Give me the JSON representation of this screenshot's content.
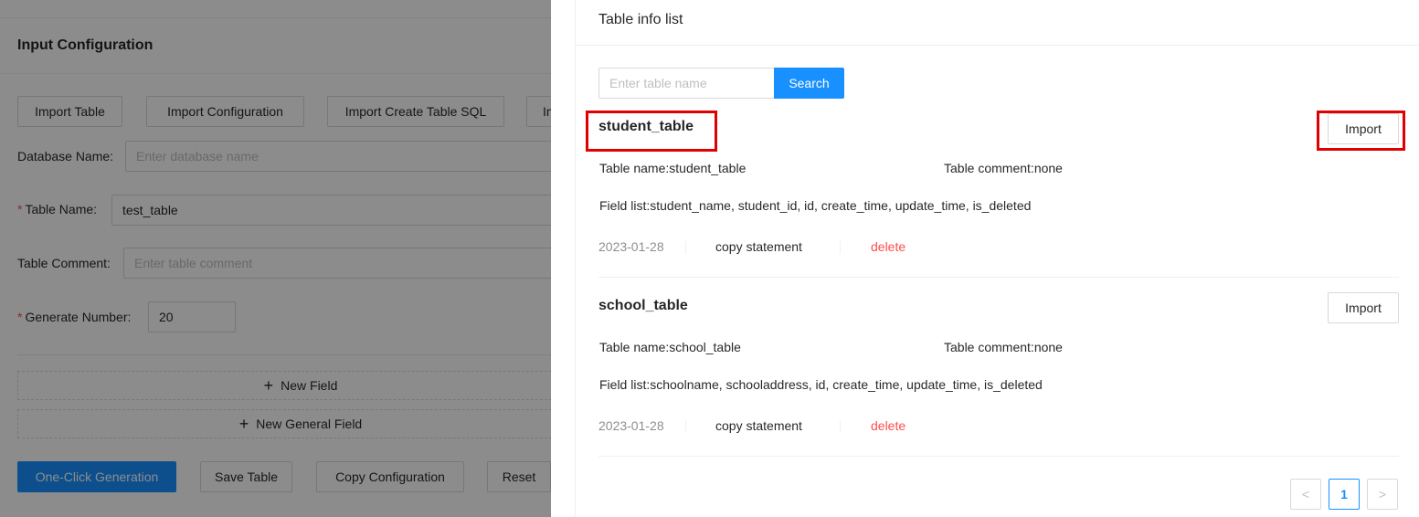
{
  "background_form": {
    "title": "Input Configuration",
    "toolbar": {
      "import_table": "Import Table",
      "import_configuration": "Import Configuration",
      "import_create_table_sql": "Import Create Table SQL",
      "import_more_truncated": "Im"
    },
    "fields": {
      "database_name": {
        "label": "Database Name:",
        "placeholder": "Enter database name",
        "value": ""
      },
      "table_name": {
        "label": "Table Name:",
        "required": true,
        "value": "test_table"
      },
      "table_comment": {
        "label": "Table Comment:",
        "placeholder": "Enter table comment",
        "value": ""
      },
      "generate_number": {
        "label": "Generate Number:",
        "required": true,
        "value": "20"
      }
    },
    "new_field_label": "New Field",
    "new_general_field_label": "New General Field",
    "actions": {
      "one_click_generation": "One-Click Generation",
      "save_table": "Save Table",
      "copy_configuration": "Copy Configuration",
      "reset": "Reset"
    }
  },
  "drawer": {
    "title": "Table info list",
    "search": {
      "placeholder": "Enter table name",
      "button_label": "Search"
    },
    "tables": [
      {
        "title": "student_table",
        "table_name_label": "Table name:",
        "table_name": "student_table",
        "table_comment_label": "Table comment:",
        "table_comment": "none",
        "field_list_label": "Field list:",
        "field_list": "student_name, student_id, id, create_time, update_time, is_deleted",
        "date": "2023-01-28",
        "copy_label": "copy statement",
        "delete_label": "delete",
        "import_label": "Import",
        "highlighted": true
      },
      {
        "title": "school_table",
        "table_name_label": "Table name:",
        "table_name": "school_table",
        "table_comment_label": "Table comment:",
        "table_comment": "none",
        "field_list_label": "Field list:",
        "field_list": "schoolname, schooladdress, id, create_time, update_time, is_deleted",
        "date": "2023-01-28",
        "copy_label": "copy statement",
        "delete_label": "delete",
        "import_label": "Import",
        "highlighted": false
      }
    ],
    "pagination": {
      "prev": "<",
      "current": "1",
      "next": ">"
    }
  },
  "colors": {
    "primary": "#1890ff",
    "danger": "#ff4d4f",
    "highlight_box": "#e00000",
    "mask": "rgba(0,0,0,0.45)"
  }
}
